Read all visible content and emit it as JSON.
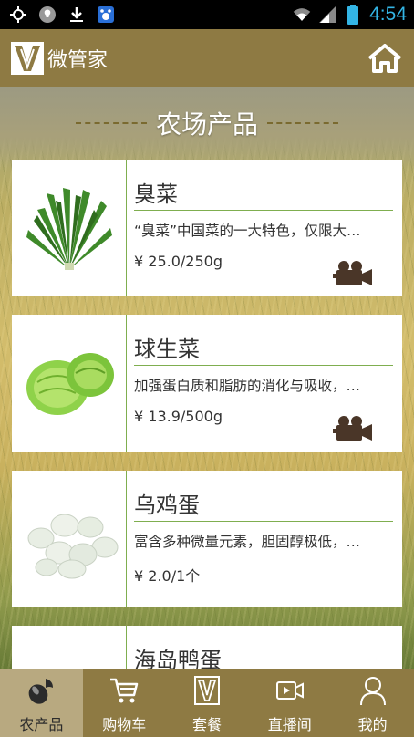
{
  "status_bar": {
    "time": "4:54",
    "icons": [
      "gps-icon",
      "bulb-icon",
      "download-icon",
      "baidu-icon",
      "wifi-icon",
      "signal-icon",
      "battery-icon"
    ]
  },
  "header": {
    "logo_icon": "vg-logo-icon",
    "title": "微管家",
    "home_icon": "home-icon"
  },
  "section": {
    "title": "农场产品"
  },
  "products": [
    {
      "name": "臭菜",
      "description": "“臭菜”中国菜的一大特色，仅限大…",
      "price": "¥ 25.0/250g",
      "has_video": true
    },
    {
      "name": "球生菜",
      "description": "加强蛋白质和脂肪的消化与吸收，…",
      "price": "¥ 13.9/500g",
      "has_video": true
    },
    {
      "name": "乌鸡蛋",
      "description": "富含多种微量元素，胆固醇极低，…",
      "price": "¥ 2.0/1个",
      "has_video": false
    },
    {
      "name": "海岛鸭蛋",
      "description": "",
      "price": "",
      "has_video": false
    }
  ],
  "bottom_nav": [
    {
      "label": "农产品",
      "icon": "eggplant-icon",
      "active": true
    },
    {
      "label": "购物车",
      "icon": "cart-icon",
      "active": false
    },
    {
      "label": "套餐",
      "icon": "package-icon",
      "active": false
    },
    {
      "label": "直播间",
      "icon": "video-room-icon",
      "active": false
    },
    {
      "label": "我的",
      "icon": "user-icon",
      "active": false
    }
  ],
  "colors": {
    "header_bg": "#8e7a43",
    "nav_active_bg": "#b8a980",
    "divider_green": "#7fae4f",
    "time_blue": "#33b5e5"
  }
}
